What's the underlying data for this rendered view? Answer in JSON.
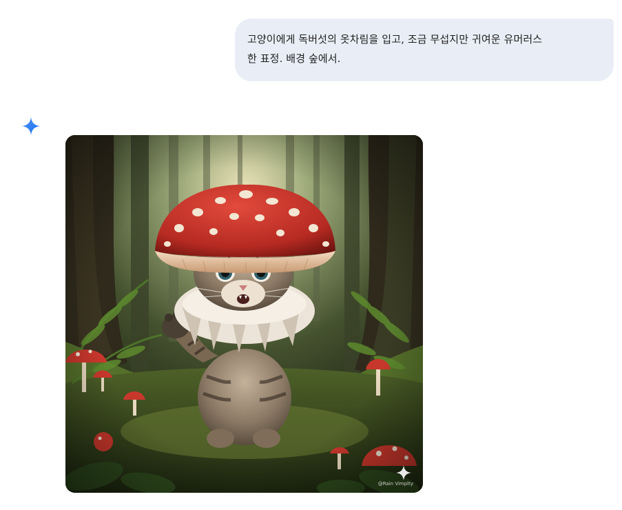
{
  "conversation": {
    "user_prompt": {
      "line1": "고양이에게 독버섯의 옷차림을 입고, 조금 무섭지만 귀여운 유머러스",
      "line2": "한 표정. 배경 숲에서."
    },
    "response": {
      "assistant_icon": "gemini-spark-icon",
      "image": {
        "watermark_text": "@Rain Vimplty",
        "watermark_icon": "sparkle-icon"
      }
    }
  },
  "colors": {
    "bubble_bg": "#e9eef6",
    "gemini_blue": "#4285f4",
    "mushroom_red": "#c8312a"
  }
}
